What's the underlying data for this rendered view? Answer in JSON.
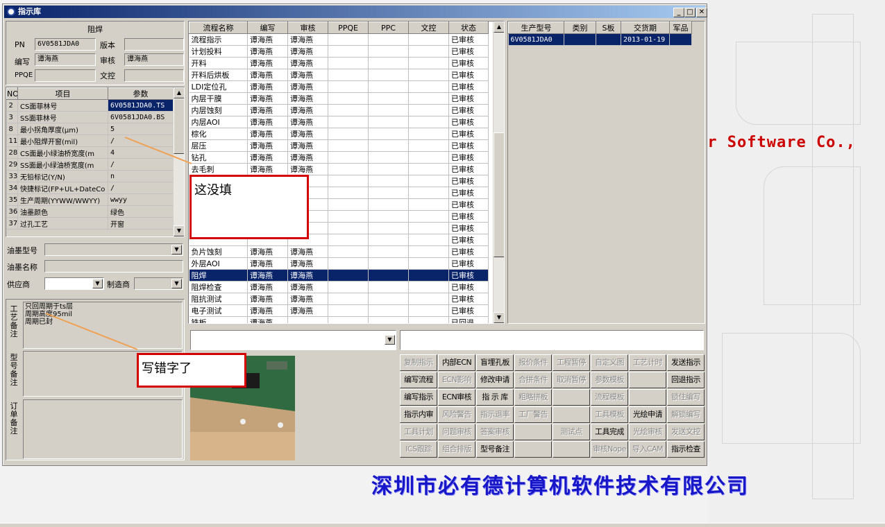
{
  "window": {
    "title": "指示库",
    "min": "_",
    "max": "□",
    "close": "✕"
  },
  "top_panel": {
    "title": "阻焊",
    "pn_label": "PN",
    "pn_value": "6V0581JDA0",
    "version_label": "版本",
    "version_value": "",
    "writer_label": "编写",
    "writer_value": "谭海燕",
    "review_label": "审核",
    "review_value": "谭海燕",
    "ppqe_label": "PPQE",
    "ppqe_value": "",
    "wenkong_label": "文控",
    "wenkong_value": ""
  },
  "param_table": {
    "headers": [
      "NO",
      "项目",
      "参数"
    ],
    "rows": [
      [
        "2",
        "CS面菲林号",
        "6V0581JDA0.TS"
      ],
      [
        "3",
        "SS面菲林号",
        "6V0581JDA0.BS"
      ],
      [
        "8",
        "最小拐角厚度(μm)",
        "5"
      ],
      [
        "11",
        "最小阻焊开窗(mil)",
        "/"
      ],
      [
        "28",
        "CS面最小绿油桥宽度(m",
        "4"
      ],
      [
        "29",
        "SS面最小绿油桥宽度(m",
        "/"
      ],
      [
        "33",
        "无铅标记(Y/N)",
        "n"
      ],
      [
        "34",
        "快捷标记(FP+UL+DateCo",
        "/"
      ],
      [
        "35",
        "生产周期(YYWW/WWYY)",
        "wwyy"
      ],
      [
        "36",
        "油墨颜色",
        "绿色"
      ],
      [
        "37",
        "过孔工艺",
        "开窗"
      ]
    ]
  },
  "ink": {
    "type_label": "油墨型号",
    "type_value": "",
    "name_label": "油墨名称",
    "name_value": "",
    "supplier_label": "供应商",
    "supplier_value": "",
    "maker_label": "制造商",
    "maker_value": ""
  },
  "notes": {
    "process_label": "工艺备注",
    "process_text": "只回周期于ts层\n周期高度95mil\n周期已封",
    "model_label": "型号备注",
    "model_text": "",
    "order_label": "订单备注",
    "order_text": ""
  },
  "flow_table": {
    "headers": [
      "流程名称",
      "编写",
      "审核",
      "PPQE",
      "PPC",
      "文控",
      "状态"
    ],
    "rows": [
      [
        "流程指示",
        "谭海燕",
        "谭海燕",
        "",
        "",
        "",
        "已审核"
      ],
      [
        "计划投料",
        "谭海燕",
        "谭海燕",
        "",
        "",
        "",
        "已审核"
      ],
      [
        "开料",
        "谭海燕",
        "谭海燕",
        "",
        "",
        "",
        "已审核"
      ],
      [
        "开料后烘板",
        "谭海燕",
        "谭海燕",
        "",
        "",
        "",
        "已审核"
      ],
      [
        "LDI定位孔",
        "谭海燕",
        "谭海燕",
        "",
        "",
        "",
        "已审核"
      ],
      [
        "内层干膜",
        "谭海燕",
        "谭海燕",
        "",
        "",
        "",
        "已审核"
      ],
      [
        "内层蚀刻",
        "谭海燕",
        "谭海燕",
        "",
        "",
        "",
        "已审核"
      ],
      [
        "内层AOI",
        "谭海燕",
        "谭海燕",
        "",
        "",
        "",
        "已审核"
      ],
      [
        "棕化",
        "谭海燕",
        "谭海燕",
        "",
        "",
        "",
        "已审核"
      ],
      [
        "层压",
        "谭海燕",
        "谭海燕",
        "",
        "",
        "",
        "已审核"
      ],
      [
        "钻孔",
        "谭海燕",
        "谭海燕",
        "",
        "",
        "",
        "已审核"
      ],
      [
        "去毛刺",
        "谭海燕",
        "谭海燕",
        "",
        "",
        "",
        "已审核"
      ],
      [
        "",
        "",
        "",
        "",
        "",
        "",
        "已审核"
      ],
      [
        "",
        "",
        "",
        "",
        "",
        "",
        "已审核"
      ],
      [
        "",
        "",
        "",
        "",
        "",
        "",
        "已审核"
      ],
      [
        "",
        "",
        "",
        "",
        "",
        "",
        "已审核"
      ],
      [
        "",
        "",
        "",
        "",
        "",
        "",
        "已审核"
      ],
      [
        "",
        "",
        "",
        "",
        "",
        "",
        "已审核"
      ],
      [
        "负片蚀刻",
        "谭海燕",
        "谭海燕",
        "",
        "",
        "",
        "已审核"
      ],
      [
        "外层AOI",
        "谭海燕",
        "谭海燕",
        "",
        "",
        "",
        "已审核"
      ],
      [
        "阻焊",
        "谭海燕",
        "谭海燕",
        "",
        "",
        "",
        "已审核"
      ],
      [
        "阻焊检查",
        "谭海燕",
        "谭海燕",
        "",
        "",
        "",
        "已审核"
      ],
      [
        "阻抗测试",
        "谭海燕",
        "谭海燕",
        "",
        "",
        "",
        "已审核"
      ],
      [
        "电子测试",
        "谭海燕",
        "谭海燕",
        "",
        "",
        "",
        "已审核"
      ],
      [
        "铣板",
        "谭海燕",
        "",
        "",
        "",
        "",
        "已回退"
      ]
    ]
  },
  "model_table": {
    "headers": [
      "生产型号",
      "类别",
      "S板",
      "交货期",
      "军品"
    ],
    "rows": [
      [
        "6V0581JDA0",
        "",
        "",
        "2013-01-19",
        ""
      ]
    ]
  },
  "buttons": [
    [
      {
        "t": "复制指示",
        "d": true
      },
      {
        "t": "内部ECN",
        "d": false
      },
      {
        "t": "盲埋孔板",
        "d": false
      },
      {
        "t": "报价条件",
        "d": true
      },
      {
        "t": "工程暂停",
        "d": true
      },
      {
        "t": "自定义图",
        "d": true
      },
      {
        "t": "工艺计时",
        "d": true
      },
      {
        "t": "发送指示",
        "d": false
      }
    ],
    [
      {
        "t": "编写流程",
        "d": false
      },
      {
        "t": "ECN影响",
        "d": true
      },
      {
        "t": "修改申请",
        "d": false
      },
      {
        "t": "合拼条件",
        "d": true
      },
      {
        "t": "取消暂停",
        "d": true
      },
      {
        "t": "参数模板",
        "d": true
      },
      {
        "t": "",
        "d": true
      },
      {
        "t": "回退指示",
        "d": false
      }
    ],
    [
      {
        "t": "编写指示",
        "d": false
      },
      {
        "t": "ECN审核",
        "d": false
      },
      {
        "t": "指 示 库",
        "d": false
      },
      {
        "t": "粗略拼板",
        "d": true
      },
      {
        "t": "",
        "d": true
      },
      {
        "t": "流程模板",
        "d": true
      },
      {
        "t": "",
        "d": true
      },
      {
        "t": "锁住编写",
        "d": true
      }
    ],
    [
      {
        "t": "指示内审",
        "d": false
      },
      {
        "t": "风险警告",
        "d": true
      },
      {
        "t": "指示退率",
        "d": true
      },
      {
        "t": "工厂警告",
        "d": true
      },
      {
        "t": "",
        "d": true
      },
      {
        "t": "工具模板",
        "d": true
      },
      {
        "t": "光绘申请",
        "d": false
      },
      {
        "t": "解锁编写",
        "d": true
      }
    ],
    [
      {
        "t": "工具计划",
        "d": true
      },
      {
        "t": "问题审核",
        "d": true
      },
      {
        "t": "答案审核",
        "d": true
      },
      {
        "t": "",
        "d": true
      },
      {
        "t": "测试点",
        "d": true
      },
      {
        "t": "工具完成",
        "d": false
      },
      {
        "t": "光绘审核",
        "d": true
      },
      {
        "t": "发送文控",
        "d": true
      }
    ],
    [
      {
        "t": "ICS跟踪",
        "d": true
      },
      {
        "t": "组合排版",
        "d": true
      },
      {
        "t": "型号备注",
        "d": false
      },
      {
        "t": "",
        "d": true
      },
      {
        "t": "",
        "d": true
      },
      {
        "t": "审核Nope",
        "d": true
      },
      {
        "t": "导入CAM",
        "d": true
      },
      {
        "t": "指示检查",
        "d": false
      }
    ]
  ],
  "callouts": {
    "c1": "这没填",
    "c2": "写错字了"
  },
  "background": {
    "company_en": "er Software Co.,",
    "company_cn": "深圳市必有德计算机软件技术有限公司"
  },
  "colors": {
    "selection": "#0a246a",
    "callout_border": "#d40000",
    "arrow": "#f0a050",
    "company_cn": "#1717c8"
  }
}
